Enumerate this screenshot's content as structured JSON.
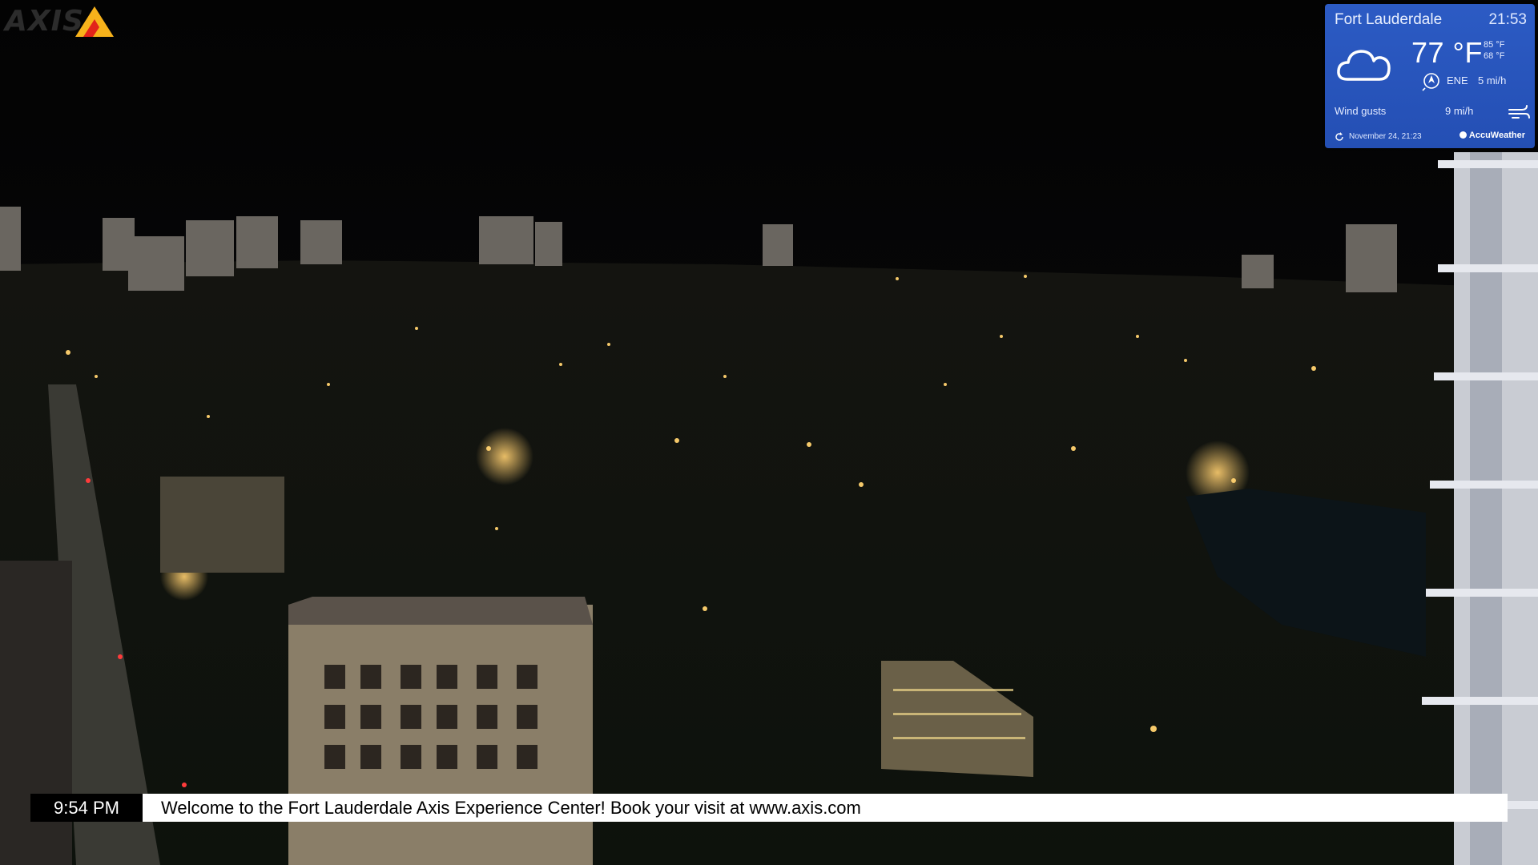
{
  "logo": {
    "text": "AXIS"
  },
  "weather": {
    "city": "Fort Lauderdale",
    "time": "21:53",
    "condition_icon": "cloud-icon",
    "temperature": "77 °F",
    "high": "85 °F",
    "low": "68 °F",
    "wind_direction": "ENE",
    "wind_speed": "5 mi/h",
    "gusts_label": "Wind gusts",
    "gusts_value": "9 mi/h",
    "updated": "November 24, 21:23",
    "provider": "AccuWeather",
    "background_color": "#2b59c3"
  },
  "ticker": {
    "time": "9:54 PM",
    "message": "Welcome to the Fort Lauderdale Axis Experience Center! Book your visit at www.axis.com"
  }
}
